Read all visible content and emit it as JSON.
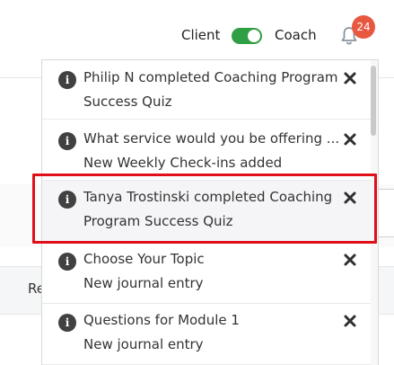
{
  "header": {
    "client_label": "Client",
    "coach_label": "Coach",
    "notification_count": "24"
  },
  "background": {
    "partial_text": "Re"
  },
  "notifications": [
    {
      "title": "Philip N completed Coaching Program",
      "subtitle": "Success Quiz"
    },
    {
      "title": "What service would you be offering ...",
      "subtitle": "New Weekly Check-ins added"
    },
    {
      "title": "Tanya Trostinski completed Coaching",
      "subtitle": "Program Success Quiz"
    },
    {
      "title": "Choose Your Topic",
      "subtitle": "New journal entry"
    },
    {
      "title": "Questions for Module 1",
      "subtitle": "New journal entry"
    }
  ],
  "colors": {
    "toggle_on": "#2f9e44",
    "badge": "#e8573f",
    "highlight_border": "#e0101a"
  },
  "icons": {
    "info": "info-icon",
    "close": "close-icon",
    "bell": "bell-icon"
  }
}
